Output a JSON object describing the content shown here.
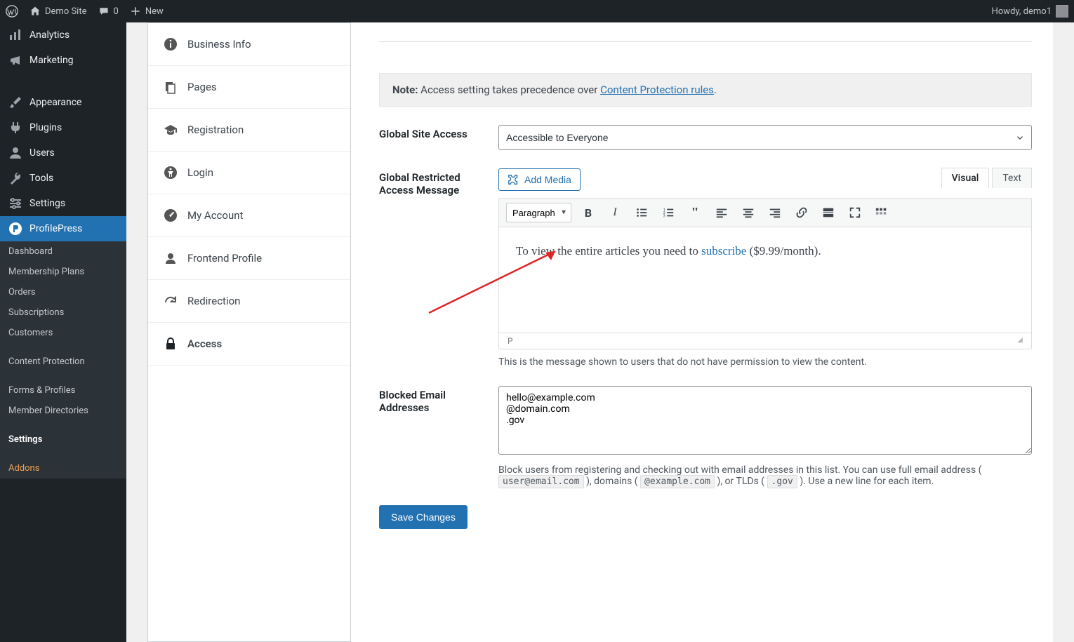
{
  "adminbar": {
    "site": "Demo Site",
    "comments": "0",
    "new": "New",
    "howdy": "Howdy, demo1"
  },
  "adminmenu": {
    "analytics": "Analytics",
    "marketing": "Marketing",
    "appearance": "Appearance",
    "plugins": "Plugins",
    "users": "Users",
    "tools": "Tools",
    "settings": "Settings",
    "profilepress": "ProfilePress"
  },
  "ppsubmenu": {
    "dashboard": "Dashboard",
    "membership_plans": "Membership Plans",
    "orders": "Orders",
    "subscriptions": "Subscriptions",
    "customers": "Customers",
    "content_protection": "Content Protection",
    "forms_profiles": "Forms & Profiles",
    "member_directories": "Member Directories",
    "settings": "Settings",
    "addons": "Addons"
  },
  "subnav": {
    "business_info": "Business Info",
    "pages": "Pages",
    "registration": "Registration",
    "login": "Login",
    "my_account": "My Account",
    "frontend_profile": "Frontend Profile",
    "redirection": "Redirection",
    "access": "Access"
  },
  "note": {
    "label": "Note:",
    "text": " Access setting takes precedence over ",
    "link": "Content Protection rules",
    "dot": "."
  },
  "global_access": {
    "label": "Global Site Access",
    "selected": "Accessible to Everyone"
  },
  "restricted_msg": {
    "label1": "Global Restricted",
    "label2": "Access Message",
    "add_media": "Add Media",
    "tab_visual": "Visual",
    "tab_text": "Text",
    "format_select": "Paragraph",
    "content_pre": "To view the entire articles you need to ",
    "content_link": "subscribe",
    "content_post": " ($9.99/month).",
    "status_path": "P",
    "desc": "This is the message shown to users that do not have permission to view the content."
  },
  "blocked": {
    "label1": "Blocked Email",
    "label2": "Addresses",
    "value": "hello@example.com\n@domain.com\n.gov",
    "desc1": "Block users from registering and checking out with email addresses in this list. You can use full email address (",
    "code1": "user@email.com",
    "desc2": "), domains (",
    "code2": "@example.com",
    "desc3": "), or TLDs (",
    "code3": ".gov",
    "desc4": "). Use a new line for each item."
  },
  "save": "Save Changes"
}
